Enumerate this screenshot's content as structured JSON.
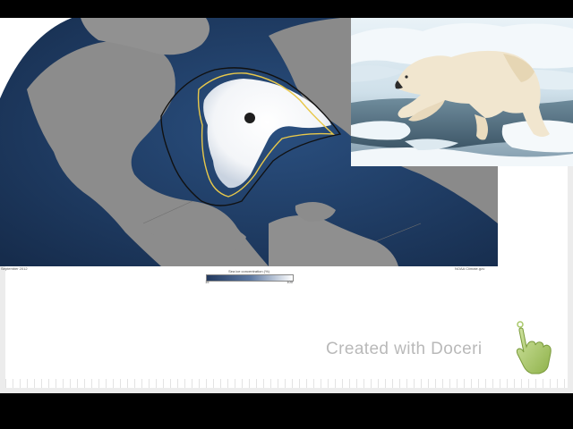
{
  "map": {
    "caption_left": "September 2012",
    "caption_right": "NOAA Climate.gov",
    "legend": {
      "title": "Sea ice concentration (%)",
      "min": "15",
      "max": "100"
    }
  },
  "watermark": {
    "text": "Created with Doceri"
  },
  "icons": {
    "photo": "polar-bear-photo",
    "hand": "pointing-hand-icon"
  },
  "colors": {
    "ocean": "#1f3d66",
    "land": "#8c8c8c",
    "ice": "#ffffff",
    "median_line": "#e8c84a",
    "historic_line": "#111111",
    "watermark": "#b9b9b9"
  }
}
